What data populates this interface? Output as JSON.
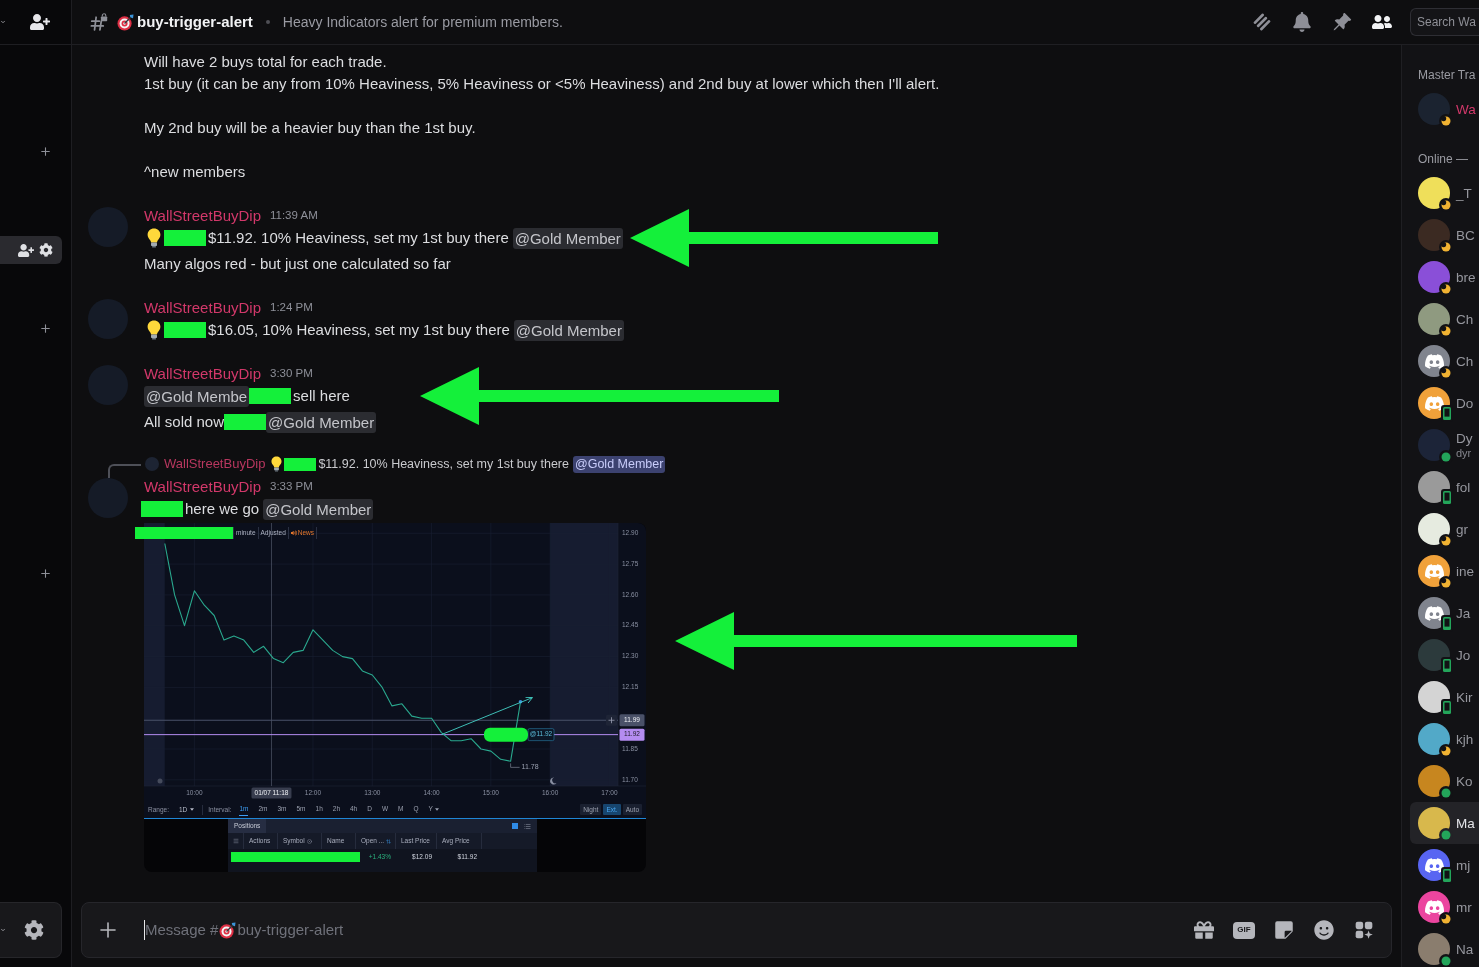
{
  "sidebar": {
    "items": [
      {
        "kind": "category"
      },
      {
        "kind": "channel",
        "selected": true
      },
      {
        "kind": "category"
      },
      {
        "kind": "category"
      }
    ]
  },
  "header": {
    "channel": "buy-trigger-alert",
    "topic": "Heavy Indicators alert for premium members.",
    "tools": [
      {
        "kind": "threads",
        "selected": false
      },
      {
        "kind": "notifications",
        "selected": false
      },
      {
        "kind": "pins",
        "selected": false
      },
      {
        "kind": "members",
        "selected": true
      }
    ],
    "search": {
      "placeholder": "Search Wa"
    }
  },
  "messages": [
    {
      "kind": "continuation",
      "paragraphs": [
        [
          "Will have 2 buys total for each trade.",
          "1st buy (it can be any from 10% Heaviness, 5% Heaviness or <5% Heaviness) and 2nd buy at lower which then I'll alert."
        ],
        [
          "My 2nd buy will be a heavier buy than the 1st buy."
        ],
        [
          "^new members"
        ]
      ]
    },
    {
      "kind": "message",
      "author": "WallStreetBuyDip",
      "time": "11:39 AM",
      "lines": [
        {
          "parts": [
            {
              "kind": "emoji"
            },
            {
              "kind": "redaction"
            },
            {
              "kind": "text",
              "text": "$11.92. 10% Heaviness, set my 1st buy there"
            },
            {
              "kind": "mention",
              "text": "@Gold Member",
              "highlighted": false
            }
          ],
          "pointer_arrow": true
        },
        {
          "parts": [
            {
              "kind": "text",
              "text": "Many algos red - but just one calculated so far"
            }
          ]
        }
      ]
    },
    {
      "kind": "message",
      "author": "WallStreetBuyDip",
      "time": "1:24 PM",
      "lines": [
        {
          "parts": [
            {
              "kind": "emoji"
            },
            {
              "kind": "redaction"
            },
            {
              "kind": "text",
              "text": "$16.05, 10% Heaviness, set my 1st buy there"
            },
            {
              "kind": "mention",
              "text": "@Gold Member",
              "highlighted": false
            }
          ]
        }
      ]
    },
    {
      "kind": "message",
      "author": "WallStreetBuyDip",
      "time": "3:30 PM",
      "lines": [
        {
          "parts": [
            {
              "kind": "mention",
              "text": "@Gold Membe",
              "highlighted": false
            },
            {
              "kind": "redaction"
            },
            {
              "kind": "text",
              "text": "sell here"
            }
          ],
          "pointer_arrow": true
        },
        {
          "parts": [
            {
              "kind": "text",
              "text": "All sold now"
            },
            {
              "kind": "redaction"
            },
            {
              "kind": "mention",
              "text": "@Gold Member",
              "highlighted": false
            }
          ]
        }
      ]
    },
    {
      "kind": "message",
      "reply": {
        "author": "WallStreetBuyDip",
        "parts": [
          {
            "kind": "emoji"
          },
          {
            "kind": "redaction"
          },
          {
            "kind": "text",
            "text": "$11.92. 10% Heaviness, set my 1st buy there"
          },
          {
            "kind": "mention",
            "text": "@Gold Member",
            "highlighted": true
          }
        ]
      },
      "author": "WallStreetBuyDip",
      "time": "3:33 PM",
      "lines": [
        {
          "parts": [
            {
              "kind": "redaction"
            },
            {
              "kind": "text",
              "text": "here we go"
            },
            {
              "kind": "mention",
              "text": "@Gold Member",
              "highlighted": false
            }
          ]
        }
      ],
      "attachment": {
        "kind": "chart_screenshot",
        "pointer_arrow": true,
        "tag_redacted": true,
        "trend_arrow": true,
        "toolbar": [
          {
            "kind": "redaction"
          },
          {
            "kind": "label",
            "text": "minute"
          },
          {
            "kind": "label",
            "text": "Adjusted"
          },
          {
            "kind": "news",
            "text": "News"
          }
        ],
        "chart_data": {
          "type": "line",
          "x": [
            570,
            580,
            590,
            600,
            610,
            620,
            630,
            640,
            650,
            660,
            670,
            680,
            690,
            700,
            710,
            720,
            730,
            740,
            750,
            760,
            770,
            780,
            790,
            800,
            810,
            820,
            830,
            840,
            850,
            860,
            870,
            880,
            890,
            900,
            910,
            920,
            930
          ],
          "values": [
            12.85,
            12.6,
            12.45,
            12.62,
            12.55,
            12.5,
            12.38,
            12.4,
            12.38,
            12.32,
            12.35,
            12.29,
            12.27,
            12.32,
            12.33,
            12.43,
            12.38,
            12.33,
            12.3,
            12.29,
            12.23,
            12.21,
            12.15,
            12.06,
            12.07,
            12.01,
            12,
            12,
            11.93,
            11.89,
            11.89,
            11.9,
            11.85,
            11.84,
            11.8,
            11.79,
            12.08
          ],
          "xlim": [
            549,
            1057
          ],
          "ylim": [
            11.67,
            12.95
          ],
          "grid": true,
          "xticks": [
            {
              "value": 600,
              "label": "10:00"
            },
            {
              "value": 720,
              "label": "12:00"
            },
            {
              "value": 780,
              "label": "13:00"
            },
            {
              "value": 840,
              "label": "14:00"
            },
            {
              "value": 900,
              "label": "15:00"
            },
            {
              "value": 960,
              "label": "16:00"
            },
            {
              "value": 1020,
              "label": "17:00"
            }
          ],
          "yticks": [
            {
              "value": 12.9,
              "label": "12.90"
            },
            {
              "value": 12.75,
              "label": "12.75"
            },
            {
              "value": 12.6,
              "label": "12.60"
            },
            {
              "value": 12.45,
              "label": "12.45"
            },
            {
              "value": 12.3,
              "label": "12.30"
            },
            {
              "value": 12.15,
              "label": "12.15"
            },
            {
              "value": 11.85,
              "label": "11.85"
            },
            {
              "value": 11.7,
              "label": "11.70"
            }
          ],
          "bands": [
            {
              "axis": "x",
              "from": 549,
              "to": 570
            },
            {
              "axis": "x",
              "from": 960,
              "to": 1029
            }
          ],
          "ref_lines": [
            {
              "axis": "x",
              "value": 678,
              "color": "#5c6376"
            },
            {
              "axis": "y",
              "value": 11.99,
              "label": "11.99",
              "color": "#4a5168"
            },
            {
              "axis": "y",
              "value": 11.92,
              "label": "11.92",
              "color": "#b48cf0"
            }
          ],
          "annotations": [
            "01/07 11:18",
            "@11.92",
            "11.78"
          ]
        },
        "range_bar": {
          "range_label": "Range:",
          "range": "1D",
          "interval_label": "Interval:",
          "intervals": [
            {
              "label": "1m",
              "kind": "option",
              "selected": true
            },
            {
              "label": "2m",
              "kind": "option",
              "selected": false
            },
            {
              "label": "3m",
              "kind": "option",
              "selected": false
            },
            {
              "label": "5m",
              "kind": "option",
              "selected": false
            },
            {
              "label": "1h",
              "kind": "option",
              "selected": false
            },
            {
              "label": "2h",
              "kind": "option",
              "selected": false
            },
            {
              "label": "4h",
              "kind": "option",
              "selected": false
            },
            {
              "label": "D",
              "kind": "option",
              "selected": false
            },
            {
              "label": "W",
              "kind": "option",
              "selected": false
            },
            {
              "label": "M",
              "kind": "option",
              "selected": false
            },
            {
              "label": "Q",
              "kind": "option",
              "selected": false
            },
            {
              "label": "Y",
              "kind": "dropdown",
              "selected": false
            }
          ],
          "sessions": [
            {
              "label": "Night",
              "selected": false
            },
            {
              "label": "Ext.",
              "selected": true
            },
            {
              "label": "Auto",
              "selected": false
            }
          ]
        },
        "positions": {
          "tab": "Positions",
          "columns": [
            {
              "label": "Actions",
              "kind": "plain"
            },
            {
              "label": "Symbol",
              "kind": "clearable"
            },
            {
              "label": "Name",
              "kind": "plain"
            },
            {
              "label": "Open ...",
              "kind": "sortable"
            },
            {
              "label": "Last Price",
              "kind": "plain"
            },
            {
              "label": "Avg Price",
              "kind": "plain"
            }
          ],
          "row": [
            {
              "kind": "redaction"
            },
            {
              "kind": "change",
              "text": "+1.43%"
            },
            {
              "kind": "price",
              "text": "$12.09"
            },
            {
              "kind": "price",
              "text": "$11.92"
            }
          ]
        }
      }
    }
  ],
  "composer": {
    "placeholder": [
      "Message #",
      "buy-trigger-alert"
    ],
    "tools": [
      {
        "kind": "gift"
      },
      {
        "kind": "gif",
        "label": "GIF"
      },
      {
        "kind": "sticker"
      },
      {
        "kind": "emoji"
      },
      {
        "kind": "apps"
      }
    ]
  },
  "member_list": {
    "groups": [
      {
        "title": "Master Tra",
        "color": "#d2386a",
        "members": [
          {
            "name": "Wa",
            "status": {
              "kind": "idle"
            },
            "avatar": {
              "kind": "photo",
              "color": "#1b2330"
            },
            "selected": false
          }
        ]
      },
      {
        "title": "Online —",
        "members": [
          {
            "name": "_T",
            "status": {
              "kind": "idle"
            },
            "avatar": {
              "kind": "photo",
              "color": "#efdf5a"
            },
            "selected": false
          },
          {
            "name": "BC",
            "status": {
              "kind": "idle"
            },
            "avatar": {
              "kind": "photo",
              "color": "#3b2a22"
            },
            "selected": false
          },
          {
            "name": "bre",
            "status": {
              "kind": "idle"
            },
            "avatar": {
              "kind": "photo",
              "color": "#8a4fd8"
            },
            "selected": false
          },
          {
            "name": "Ch",
            "status": {
              "kind": "idle"
            },
            "avatar": {
              "kind": "photo",
              "color": "#8f9a80"
            },
            "selected": false
          },
          {
            "name": "Ch",
            "status": {
              "kind": "idle"
            },
            "avatar": {
              "kind": "default",
              "color": "#80848e"
            },
            "selected": false
          },
          {
            "name": "Do",
            "status": {
              "kind": "mobile"
            },
            "avatar": {
              "kind": "default",
              "color": "#f0a13a"
            },
            "selected": false
          },
          {
            "name": "Dy",
            "subtitle": "dyr",
            "status": {
              "kind": "online"
            },
            "avatar": {
              "kind": "photo",
              "color": "#1c2438"
            },
            "selected": false
          },
          {
            "name": "fol",
            "status": {
              "kind": "mobile"
            },
            "avatar": {
              "kind": "photo",
              "color": "#9a9a9a"
            },
            "selected": false
          },
          {
            "name": "gr",
            "status": {
              "kind": "idle"
            },
            "avatar": {
              "kind": "photo",
              "color": "#e6ebe0"
            },
            "selected": false
          },
          {
            "name": "ine",
            "status": {
              "kind": "idle"
            },
            "avatar": {
              "kind": "default",
              "color": "#f0a13a"
            },
            "selected": false
          },
          {
            "name": "Ja",
            "status": {
              "kind": "mobile"
            },
            "avatar": {
              "kind": "default",
              "color": "#80848e"
            },
            "selected": false
          },
          {
            "name": "Jo",
            "status": {
              "kind": "mobile"
            },
            "avatar": {
              "kind": "photo",
              "color": "#2c3a3c"
            },
            "selected": false
          },
          {
            "name": "Kir",
            "status": {
              "kind": "mobile"
            },
            "avatar": {
              "kind": "photo",
              "color": "#d4d4d4"
            },
            "selected": false
          },
          {
            "name": "kjh",
            "status": {
              "kind": "idle"
            },
            "avatar": {
              "kind": "photo",
              "color": "#52a9c8"
            },
            "selected": false
          },
          {
            "name": "Ko",
            "status": {
              "kind": "online"
            },
            "avatar": {
              "kind": "photo",
              "color": "#c7861f"
            },
            "selected": false
          },
          {
            "name": "Ma",
            "status": {
              "kind": "online"
            },
            "avatar": {
              "kind": "photo",
              "color": "#d8b84c"
            },
            "selected": true
          },
          {
            "name": "mj",
            "status": {
              "kind": "mobile"
            },
            "avatar": {
              "kind": "default",
              "color": "#5865f2"
            },
            "selected": false
          },
          {
            "name": "mr",
            "status": {
              "kind": "idle"
            },
            "avatar": {
              "kind": "default",
              "color": "#eb459f"
            },
            "selected": false
          },
          {
            "name": "Na",
            "status": {
              "kind": "online"
            },
            "avatar": {
              "kind": "photo",
              "color": "#8a7d6e"
            },
            "selected": false
          }
        ]
      }
    ]
  }
}
